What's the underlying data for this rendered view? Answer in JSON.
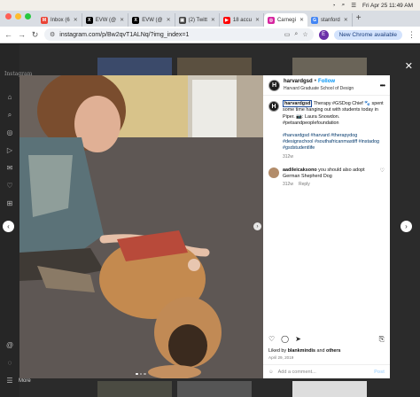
{
  "menubar": {
    "datetime": "Fri Apr 25  11:49 AM"
  },
  "tabs": [
    {
      "favicon": "gmail-icon",
      "label": "Inbox (6",
      "color": "#ea4335"
    },
    {
      "favicon": "x-icon",
      "label": "EVW (@",
      "color": "#000000"
    },
    {
      "favicon": "x-icon",
      "label": "EVW (@",
      "color": "#000000"
    },
    {
      "favicon": "twitch-icon",
      "label": "(2) Twitt",
      "color": "#444444"
    },
    {
      "favicon": "youtube-icon",
      "label": "18 accu",
      "color": "#ff0000"
    },
    {
      "favicon": "instagram-icon",
      "label": "Carnegi",
      "color": "#d6249f",
      "active": true
    },
    {
      "favicon": "google-icon",
      "label": "stanford",
      "color": "#4285f4"
    }
  ],
  "address": {
    "url": "instagram.com/p/Bw2qvT1ALNq/?img_index=1",
    "profile_letter": "E",
    "new_chrome": "New Chrome available"
  },
  "instagram": {
    "logo": "Instagram",
    "more_label": "More"
  },
  "post": {
    "username": "harvardgsd",
    "follow": "Follow",
    "subtitle": "Harvard Graduate School of Design",
    "avatar_letter": "H",
    "caption_user": "harvardgsd",
    "caption_body": " Therapy #GSDog Chief 🐾 spent some time hanging out with students today in Piper. 📷: Laura Snowdon. #petsandpeoplefoundation",
    "hashtags": "#harvardgsd #harvard #therapydog #designschool #southafricanmastiff #instadog #gsdstudentlife",
    "caption_time": "312w",
    "comment": {
      "user": "aadileicaksono",
      "text": " you should also adopt German Shepherd Dog",
      "time": "312w",
      "reply": "Reply"
    },
    "liked_prefix": "Liked by ",
    "liked_user": "blankmindis",
    "liked_and": " and ",
    "liked_others": "others",
    "date": "April 29, 2019",
    "add_comment_placeholder": "Add a comment...",
    "post_button": "Post"
  }
}
